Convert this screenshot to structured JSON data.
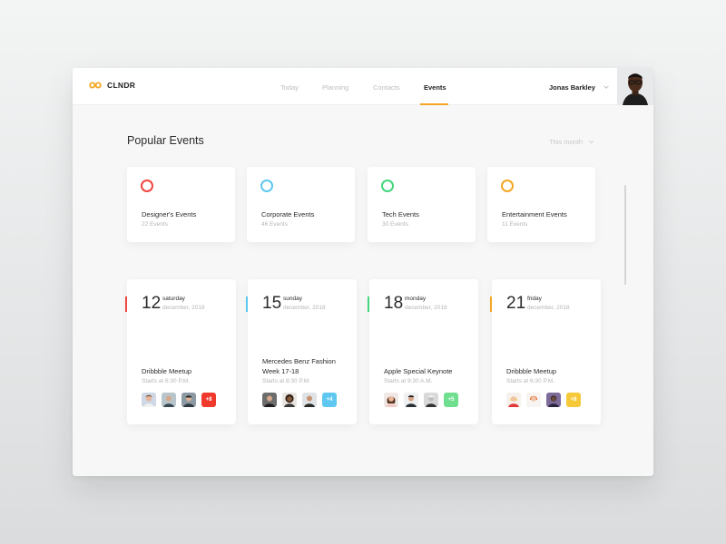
{
  "app": {
    "logo_text": "CLNDR",
    "accent_color": "#f5a623"
  },
  "nav": {
    "items": [
      {
        "label": "Today",
        "active": false
      },
      {
        "label": "Planning",
        "active": false
      },
      {
        "label": "Contacts",
        "active": false
      },
      {
        "label": "Events",
        "active": true
      }
    ]
  },
  "user": {
    "name": "Jonas Barkley",
    "avatar_icon": "user-avatar"
  },
  "main": {
    "section_title": "Popular Events",
    "period_filter": "This month",
    "categories": [
      {
        "title": "Designer's Events",
        "count": "22 Events",
        "color": "#f0463f"
      },
      {
        "title": "Corporate Events",
        "count": "46 Events",
        "color": "#5ec8f0"
      },
      {
        "title": "Tech Events",
        "count": "30 Events",
        "color": "#44d67c"
      },
      {
        "title": "Entertainment Events",
        "count": "11 Events",
        "color": "#f5a623"
      }
    ],
    "events": [
      {
        "day": "12",
        "weekday": "saturday",
        "month": "december, 2018",
        "title": "Dribbble Meetup",
        "time": "Starts at 6:30 P.M.",
        "accent": "#f0463f",
        "more": "+8",
        "badge_color": "#f0392d"
      },
      {
        "day": "15",
        "weekday": "sunday",
        "month": "december, 2018",
        "title": "Mercedes Benz Fashion Week 17-18",
        "time": "Starts at 8:30 P.M.",
        "accent": "#5ec8f0",
        "more": "+4",
        "badge_color": "#5ec8f0"
      },
      {
        "day": "18",
        "weekday": "monday",
        "month": "december, 2018",
        "title": "Apple Special Keynote",
        "time": "Starts at 9:30 A.M.",
        "accent": "#44d67c",
        "more": "+5",
        "badge_color": "#6fdf8f"
      },
      {
        "day": "21",
        "weekday": "friday",
        "month": "december, 2018",
        "title": "Dribbble Meetup",
        "time": "Starts at 6:30 P.M.",
        "accent": "#f5a623",
        "more": "+8",
        "badge_color": "#f5c93a"
      }
    ]
  }
}
